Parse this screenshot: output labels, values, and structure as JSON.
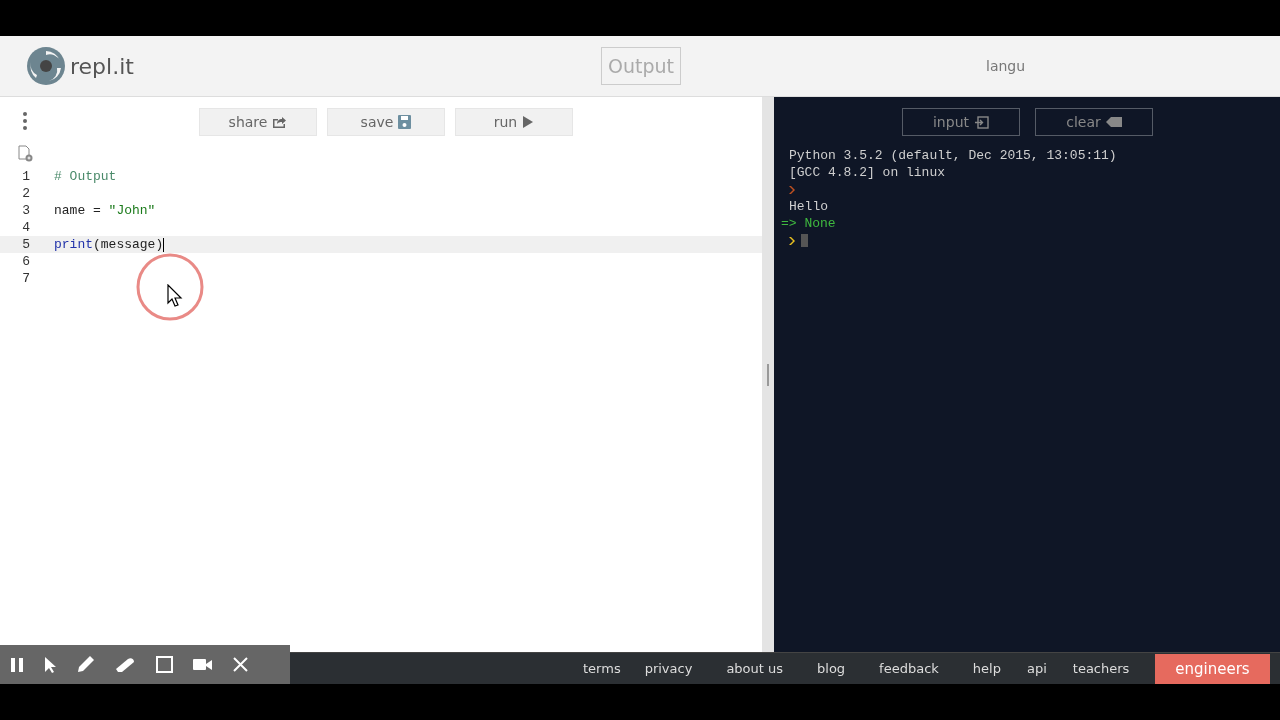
{
  "header": {
    "logo_text": "repl.it",
    "view_label": "Output",
    "language_label": "langu"
  },
  "editor": {
    "toolbar": [
      {
        "label": "share",
        "kind": "share"
      },
      {
        "label": "save",
        "kind": "save"
      },
      {
        "label": "run",
        "kind": "run"
      }
    ],
    "lines": [
      {
        "number": "1",
        "active": false,
        "tokens": [
          {
            "text": "# Output",
            "kind": "comment"
          }
        ]
      },
      {
        "number": "2",
        "active": false
      },
      {
        "number": "3",
        "active": false,
        "tokens": [
          {
            "text": "name = ",
            "kind": "plain"
          },
          {
            "text": "\"John\"",
            "kind": "string"
          }
        ]
      },
      {
        "number": "4",
        "active": false
      },
      {
        "number": "5",
        "active": true,
        "tokens": [
          {
            "text": "print",
            "kind": "keyword"
          },
          {
            "text": "(message)",
            "kind": "plain"
          }
        ]
      },
      {
        "number": "6",
        "active": false
      },
      {
        "number": "7",
        "active": false
      }
    ]
  },
  "console": {
    "buttons": [
      {
        "label": "input",
        "kind": "input"
      },
      {
        "label": "clear",
        "kind": "clear"
      }
    ],
    "lines": [
      {
        "kind": "text",
        "text": "Python 3.5.2 (default, Dec 2015, 13:05:11)"
      },
      {
        "kind": "text",
        "text": "[GCC 4.8.2] on linux"
      },
      {
        "kind": "prompt",
        "active": false
      },
      {
        "kind": "text",
        "text": "Hello"
      },
      {
        "kind": "result",
        "text": "=> None"
      },
      {
        "kind": "prompt",
        "active": true
      }
    ]
  },
  "footer": {
    "links": [
      {
        "label": "terms",
        "kind": "link"
      },
      {
        "label": "privacy",
        "kind": "link"
      },
      {
        "label": "about us",
        "kind": "link"
      },
      {
        "label": "blog",
        "kind": "link"
      },
      {
        "label": "feedback",
        "kind": "link"
      },
      {
        "label": "help",
        "kind": "link"
      },
      {
        "label": "api",
        "kind": "link"
      },
      {
        "label": "teachers",
        "kind": "link"
      },
      {
        "label": "engineers",
        "kind": "button"
      }
    ]
  }
}
